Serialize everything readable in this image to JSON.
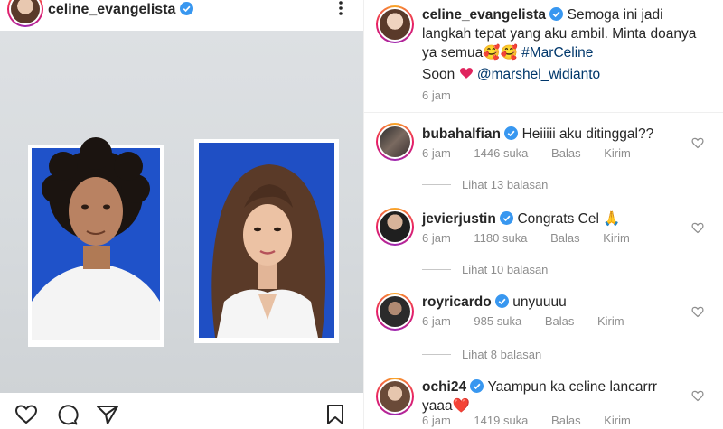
{
  "post": {
    "username": "celine_evangelista",
    "verified": true,
    "more_icon": "more-dots-icon"
  },
  "photo": {
    "description_icons": [
      "id-photo-left",
      "id-photo-right"
    ]
  },
  "actions": {
    "icons": [
      "heart-icon",
      "comment-icon",
      "share-icon",
      "bookmark-icon"
    ]
  },
  "caption": {
    "username": "celine_evangelista",
    "text_line": "Semoga ini jadi langkah tepat yang aku ambil. Minta doanya ya semua🥰🥰",
    "hashtag": "#MarCeline",
    "soon_text": "Soon",
    "mention": "@marshel_widianto",
    "time": "6 jam"
  },
  "comments": [
    {
      "username": "bubahalfian",
      "verified": true,
      "text": "Heiiiii aku ditinggal??",
      "time": "6 jam",
      "likes": "1446 suka",
      "reply": "Balas",
      "send": "Kirim",
      "replies": "Lihat 13 balasan"
    },
    {
      "username": "jevierjustin",
      "verified": true,
      "text": "Congrats Cel 🙏",
      "time": "6 jam",
      "likes": "1180 suka",
      "reply": "Balas",
      "send": "Kirim",
      "replies": "Lihat 10 balasan"
    },
    {
      "username": "royricardo",
      "verified": true,
      "text": "unyuuuu",
      "time": "6 jam",
      "likes": "985 suka",
      "reply": "Balas",
      "send": "Kirim",
      "replies": "Lihat 8 balasan"
    },
    {
      "username": "ochi24",
      "verified": true,
      "text": "Yaampun ka celine lancarrr yaaa❤️",
      "time": "6 jam",
      "likes": "1419 suka",
      "reply": "Balas",
      "send": "Kirim"
    }
  ],
  "colors": {
    "accent_link": "#00376b",
    "verified_blue": "#3897f0",
    "muted": "#8e8e8e",
    "photo_bg": "#d9dcdf",
    "id_blue": "#1f4fc4",
    "heart_red": "#ed4956"
  }
}
